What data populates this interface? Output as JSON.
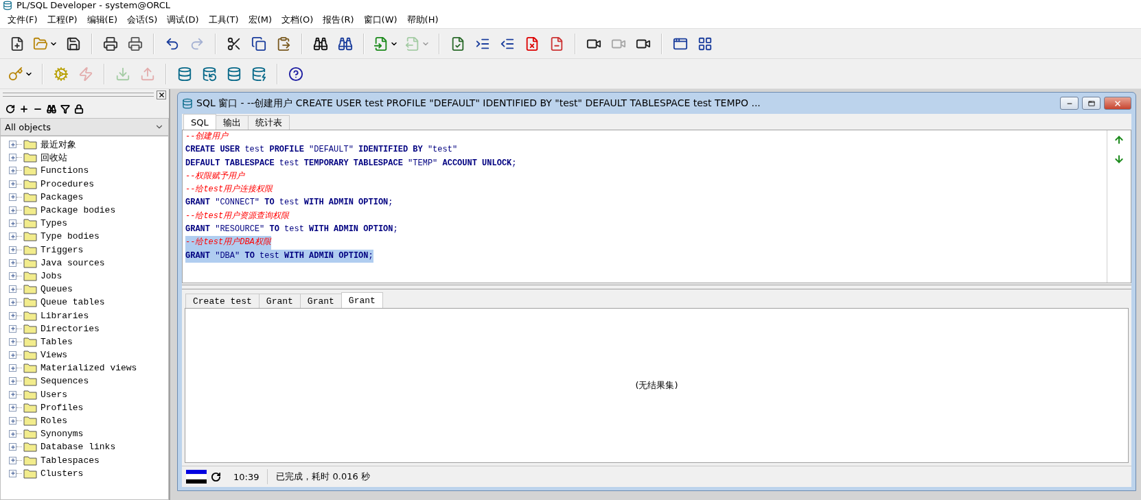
{
  "app": {
    "title": "PL/SQL Developer - system@ORCL"
  },
  "menu": [
    {
      "label": "文件(F)"
    },
    {
      "label": "工程(P)"
    },
    {
      "label": "编辑(E)"
    },
    {
      "label": "会话(S)"
    },
    {
      "label": "调试(D)"
    },
    {
      "label": "工具(T)"
    },
    {
      "label": "宏(M)"
    },
    {
      "label": "文档(O)"
    },
    {
      "label": "报告(R)"
    },
    {
      "label": "窗口(W)"
    },
    {
      "label": "帮助(H)"
    }
  ],
  "toolbars": [
    {
      "items": [
        {
          "kind": "button",
          "disabled": false,
          "dropdown": false
        },
        {
          "kind": "button",
          "disabled": false,
          "dropdown": true
        },
        {
          "kind": "button",
          "disabled": false,
          "dropdown": false
        },
        {
          "kind": "separator"
        },
        {
          "kind": "button",
          "disabled": false,
          "dropdown": false
        },
        {
          "kind": "button",
          "disabled": false,
          "dropdown": false
        },
        {
          "kind": "separator"
        },
        {
          "kind": "button",
          "disabled": false,
          "dropdown": false
        },
        {
          "kind": "button",
          "disabled": true,
          "dropdown": false
        },
        {
          "kind": "separator"
        },
        {
          "kind": "button",
          "disabled": false,
          "dropdown": false
        },
        {
          "kind": "button",
          "disabled": false,
          "dropdown": false
        },
        {
          "kind": "button",
          "disabled": false,
          "dropdown": false
        },
        {
          "kind": "separator"
        },
        {
          "kind": "button",
          "disabled": false,
          "dropdown": false
        },
        {
          "kind": "button",
          "disabled": false,
          "dropdown": false
        },
        {
          "kind": "separator"
        },
        {
          "kind": "button",
          "disabled": false,
          "dropdown": true
        },
        {
          "kind": "button",
          "disabled": true,
          "dropdown": true
        },
        {
          "kind": "separator"
        },
        {
          "kind": "button",
          "disabled": false,
          "dropdown": false
        },
        {
          "kind": "button",
          "disabled": false,
          "dropdown": false
        },
        {
          "kind": "button",
          "disabled": false,
          "dropdown": false
        },
        {
          "kind": "button",
          "disabled": false,
          "dropdown": false
        },
        {
          "kind": "button",
          "disabled": false,
          "dropdown": false
        },
        {
          "kind": "separator"
        },
        {
          "kind": "button",
          "disabled": false,
          "dropdown": false
        },
        {
          "kind": "button",
          "disabled": true,
          "dropdown": false
        },
        {
          "kind": "button",
          "disabled": false,
          "dropdown": false
        },
        {
          "kind": "separator"
        },
        {
          "kind": "button",
          "disabled": false,
          "dropdown": false
        },
        {
          "kind": "button",
          "disabled": false,
          "dropdown": false
        }
      ]
    },
    {
      "items": [
        {
          "kind": "button",
          "disabled": false,
          "dropdown": true
        },
        {
          "kind": "separator"
        },
        {
          "kind": "button",
          "disabled": false,
          "dropdown": false
        },
        {
          "kind": "button",
          "disabled": true,
          "dropdown": false
        },
        {
          "kind": "separator"
        },
        {
          "kind": "button",
          "disabled": true,
          "dropdown": false
        },
        {
          "kind": "button",
          "disabled": true,
          "dropdown": false
        },
        {
          "kind": "separator"
        },
        {
          "kind": "button",
          "disabled": false,
          "dropdown": false
        },
        {
          "kind": "button",
          "disabled": false,
          "dropdown": false
        },
        {
          "kind": "button",
          "disabled": false,
          "dropdown": false
        },
        {
          "kind": "button",
          "disabled": false,
          "dropdown": false
        },
        {
          "kind": "separator"
        },
        {
          "kind": "button",
          "disabled": false,
          "dropdown": false
        }
      ]
    }
  ],
  "object_browser": {
    "filter": "All objects",
    "items": [
      {
        "label": "最近对象",
        "expanded": false
      },
      {
        "label": "回收站",
        "expanded": false
      },
      {
        "label": "Functions",
        "expanded": false
      },
      {
        "label": "Procedures",
        "expanded": false
      },
      {
        "label": "Packages",
        "expanded": false
      },
      {
        "label": "Package bodies",
        "expanded": false
      },
      {
        "label": "Types",
        "expanded": false
      },
      {
        "label": "Type bodies",
        "expanded": false
      },
      {
        "label": "Triggers",
        "expanded": false
      },
      {
        "label": "Java sources",
        "expanded": false
      },
      {
        "label": "Jobs",
        "expanded": false
      },
      {
        "label": "Queues",
        "expanded": false
      },
      {
        "label": "Queue tables",
        "expanded": false
      },
      {
        "label": "Libraries",
        "expanded": false
      },
      {
        "label": "Directories",
        "expanded": false
      },
      {
        "label": "Tables",
        "expanded": false
      },
      {
        "label": "Views",
        "expanded": false
      },
      {
        "label": "Materialized views",
        "expanded": false
      },
      {
        "label": "Sequences",
        "expanded": false
      },
      {
        "label": "Users",
        "expanded": false
      },
      {
        "label": "Profiles",
        "expanded": false
      },
      {
        "label": "Roles",
        "expanded": false
      },
      {
        "label": "Synonyms",
        "expanded": false
      },
      {
        "label": "Database links",
        "expanded": false
      },
      {
        "label": "Tablespaces",
        "expanded": false
      },
      {
        "label": "Clusters",
        "expanded": false
      }
    ]
  },
  "sql_window": {
    "title": "SQL 窗口 - --创建用户 CREATE USER test PROFILE \"DEFAULT\" IDENTIFIED BY \"test\" DEFAULT TABLESPACE test TEMPO ...",
    "tabs": [
      {
        "label": "SQL",
        "selected": true
      },
      {
        "label": "输出",
        "selected": false
      },
      {
        "label": "统计表",
        "selected": false
      }
    ],
    "lines": [
      {
        "selected": false,
        "segments": [
          {
            "kind": "comment",
            "text": "--创建用户"
          }
        ]
      },
      {
        "selected": false,
        "segments": [
          {
            "kind": "keyword",
            "text": "CREATE USER"
          },
          {
            "kind": "plain",
            "text": " test "
          },
          {
            "kind": "keyword",
            "text": "PROFILE"
          },
          {
            "kind": "plain",
            "text": " \"DEFAULT\" "
          },
          {
            "kind": "keyword",
            "text": "IDENTIFIED BY"
          },
          {
            "kind": "plain",
            "text": " \"test\""
          }
        ]
      },
      {
        "selected": false,
        "segments": [
          {
            "kind": "keyword",
            "text": "DEFAULT TABLESPACE"
          },
          {
            "kind": "plain",
            "text": " test "
          },
          {
            "kind": "keyword",
            "text": "TEMPORARY TABLESPACE"
          },
          {
            "kind": "plain",
            "text": " \"TEMP\" "
          },
          {
            "kind": "keyword",
            "text": "ACCOUNT UNLOCK"
          },
          {
            "kind": "plain",
            "text": ";"
          }
        ]
      },
      {
        "selected": false,
        "segments": [
          {
            "kind": "comment",
            "text": "--权限赋予用户"
          }
        ]
      },
      {
        "selected": false,
        "segments": [
          {
            "kind": "comment",
            "text": "--给test用户连接权限"
          }
        ]
      },
      {
        "selected": false,
        "segments": [
          {
            "kind": "keyword",
            "text": "GRANT"
          },
          {
            "kind": "plain",
            "text": " \"CONNECT\" "
          },
          {
            "kind": "keyword",
            "text": "TO"
          },
          {
            "kind": "plain",
            "text": " test "
          },
          {
            "kind": "keyword",
            "text": "WITH ADMIN OPTION"
          },
          {
            "kind": "plain",
            "text": ";"
          }
        ]
      },
      {
        "selected": false,
        "segments": [
          {
            "kind": "comment",
            "text": "--给test用户资源查询权限"
          }
        ]
      },
      {
        "selected": false,
        "segments": [
          {
            "kind": "keyword",
            "text": "GRANT"
          },
          {
            "kind": "plain",
            "text": " \"RESOURCE\" "
          },
          {
            "kind": "keyword",
            "text": "TO"
          },
          {
            "kind": "plain",
            "text": " test "
          },
          {
            "kind": "keyword",
            "text": "WITH ADMIN OPTION"
          },
          {
            "kind": "plain",
            "text": ";"
          }
        ]
      },
      {
        "selected": true,
        "segments": [
          {
            "kind": "comment",
            "text": "--给test用户DBA权限"
          }
        ]
      },
      {
        "selected": true,
        "segments": [
          {
            "kind": "keyword",
            "text": "GRANT"
          },
          {
            "kind": "plain",
            "text": " \"DBA\" "
          },
          {
            "kind": "keyword",
            "text": "TO"
          },
          {
            "kind": "plain",
            "text": " test "
          },
          {
            "kind": "keyword",
            "text": "WITH ADMIN OPTION"
          },
          {
            "kind": "plain",
            "text": ";"
          }
        ]
      }
    ],
    "result_tabs": [
      {
        "label": "Create test",
        "selected": false
      },
      {
        "label": "Grant",
        "selected": false
      },
      {
        "label": "Grant",
        "selected": false
      },
      {
        "label": "Grant",
        "selected": true
      }
    ],
    "result_message": "(无结果集)",
    "status": {
      "time": "10:39",
      "message": "已完成，耗时 0.016 秒"
    }
  }
}
